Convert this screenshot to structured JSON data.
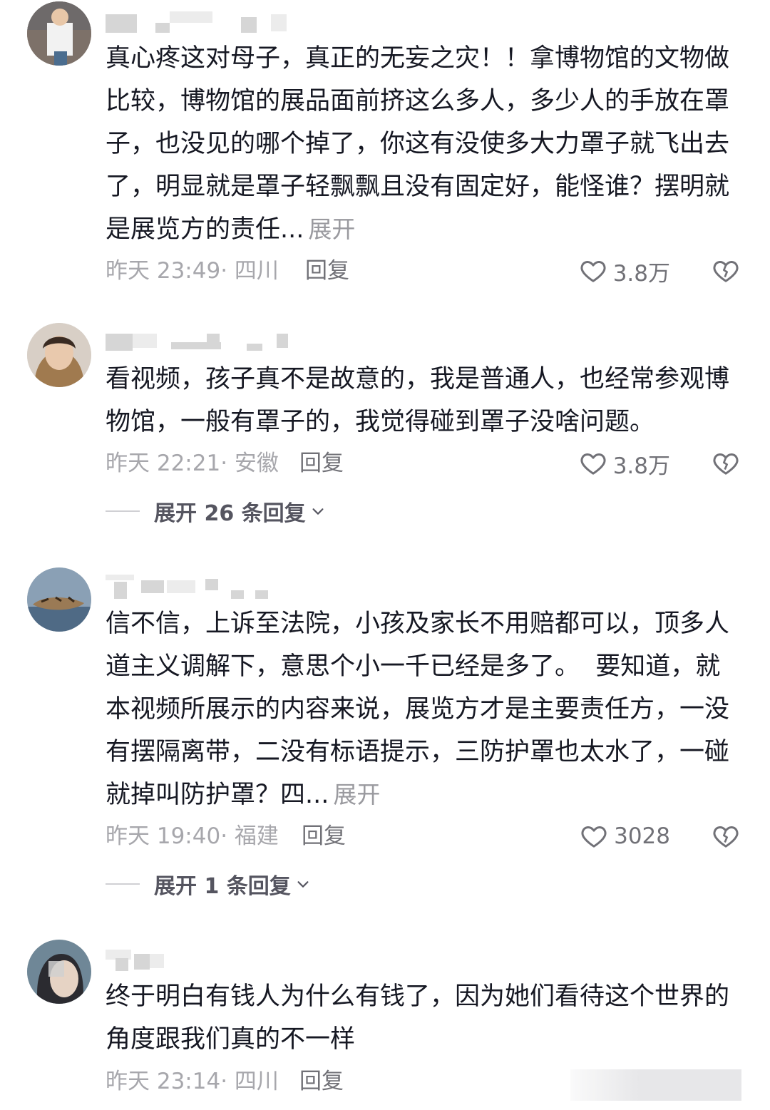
{
  "comments": [
    {
      "text": "真心疼这对母子，真正的无妄之灾！！拿博物馆的文物做比较，博物馆的展品面前挤这么多人，多少人的手放在罩子，也没见的哪个掉了，你这有没使多大力罩子就飞出去了，明显就是罩子轻飘飘且没有固定好，能怪谁？摆明就是展览方的责任...",
      "expand_label": "展开",
      "time_location": "昨天 23:49· 四川",
      "reply_label": "回复",
      "likes": "3.8万",
      "expand_replies": ""
    },
    {
      "text": "看视频，孩子真不是故意的，我是普通人，也经常参观博物馆，一般有罩子的，我觉得碰到罩子没啥问题。",
      "expand_label": "",
      "time_location": "昨天 22:21· 安徽",
      "reply_label": "回复",
      "likes": "3.8万",
      "expand_replies": "展开 26 条回复"
    },
    {
      "text": "信不信，上诉至法院，小孩及家长不用赔都可以，顶多人道主义调解下，意思个小一千已经是多了。  要知道，就本视频所展示的内容来说，展览方才是主要责任方，一没有摆隔离带，二没有标语提示，三防护罩也太水了，一碰就掉叫防护罩？四...",
      "expand_label": "展开",
      "time_location": "昨天 19:40· 福建",
      "reply_label": "回复",
      "likes": "3028",
      "expand_replies": "展开 1 条回复"
    },
    {
      "text": "终于明白有钱人为什么有钱了，因为她们看待这个世界的角度跟我们真的不一样",
      "expand_label": "",
      "time_location": "昨天 23:14· 四川",
      "reply_label": "回复",
      "likes": "",
      "expand_replies": ""
    }
  ],
  "colors": {
    "text": "#161823",
    "meta": "#a7a7ac",
    "reply": "#717177",
    "expand": "#9a9a9f"
  },
  "icons": [
    "heart-outline-icon",
    "broken-heart-icon",
    "chevron-down-icon"
  ]
}
